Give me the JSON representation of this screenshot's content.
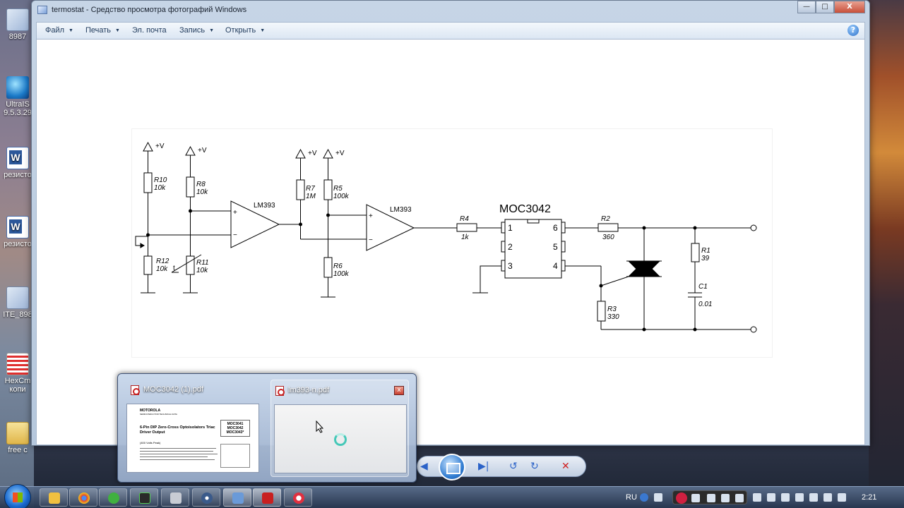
{
  "window": {
    "title": "termostat - Средство просмотра фотографий Windows",
    "controls": {
      "minimize": "—",
      "maximize": "□",
      "close": "X"
    }
  },
  "menu": {
    "items": [
      {
        "label": "Файл",
        "has_arrow": true
      },
      {
        "label": "Печать",
        "has_arrow": true
      },
      {
        "label": "Эл. почта",
        "has_arrow": false
      },
      {
        "label": "Запись",
        "has_arrow": true
      },
      {
        "label": "Открыть",
        "has_arrow": true
      }
    ],
    "help": "?"
  },
  "desktop": {
    "icons": [
      {
        "label": "8987",
        "icon": "image-icon"
      },
      {
        "label": "UltraIS 9.5.3.29",
        "icon": "globe-icon"
      },
      {
        "label": "резисто",
        "icon": "word-icon"
      },
      {
        "label": "резисто",
        "icon": "word-icon"
      },
      {
        "label": "ITE_898",
        "icon": "image-icon"
      },
      {
        "label": "HexCm копи",
        "icon": "hex-icon"
      },
      {
        "label": "free c",
        "icon": "folder-icon"
      }
    ]
  },
  "schematic": {
    "supply": "+V",
    "opamp1": "LM393",
    "opamp2": "LM393",
    "optocoupler": "MOC3042",
    "plus": "+",
    "minus": "−",
    "t_label": "t",
    "components": {
      "r10": {
        "name": "R10",
        "value": "10k"
      },
      "r8": {
        "name": "R8",
        "value": "10k"
      },
      "r12": {
        "name": "R12",
        "value": "10k"
      },
      "r11": {
        "name": "R11",
        "value": "10k"
      },
      "r7": {
        "name": "R7",
        "value": "1M"
      },
      "r5": {
        "name": "R5",
        "value": "100k"
      },
      "r6": {
        "name": "R6",
        "value": "100k"
      },
      "r4": {
        "name": "R4",
        "value": "1k"
      },
      "r2": {
        "name": "R2",
        "value": "360"
      },
      "r3": {
        "name": "R3",
        "value": "330"
      },
      "r1": {
        "name": "R1",
        "value": "39"
      },
      "c1": {
        "name": "C1",
        "value": "0.01"
      }
    },
    "pins": {
      "p1": "1",
      "p2": "2",
      "p3": "3",
      "p4": "4",
      "p5": "5",
      "p6": "6"
    }
  },
  "flyout": {
    "thumbs": [
      {
        "title": "MOC3042 (1).pdf"
      },
      {
        "title": "lm393-n.pdf"
      }
    ],
    "close": "x",
    "doc": {
      "brand": "MOTOROLA",
      "sub": "SEMICONDUCTOR TECHNICAL DATA",
      "heading": "6-Pin DIP Zero-Cross Optoisolators Triac Driver Output",
      "note": "(400 Volts Peak)",
      "parts": [
        "MOC3041",
        "MOC3042",
        "MOC3043*"
      ]
    }
  },
  "taskbar": {
    "apps": [
      "explorer",
      "chrome",
      "green-app",
      "terminal",
      "drive",
      "media",
      "photo-viewer",
      "acrobat",
      "opera"
    ],
    "language": "RU",
    "clock": "2:21"
  }
}
